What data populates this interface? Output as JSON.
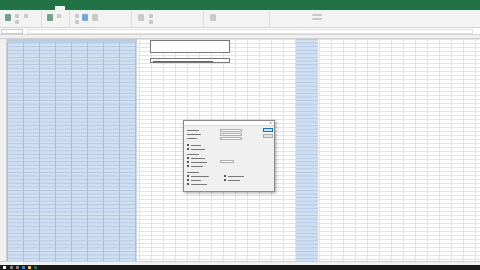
{
  "app": {
    "accent": "#217346"
  },
  "ribbon_tabs": [
    "",
    "",
    "",
    "",
    "",
    "",
    "",
    "",
    ""
  ],
  "active_tab_index": 4,
  "sheet": {
    "data_fill_color": "#cfdff2",
    "selected_column_color": "#cfdff2",
    "tabs": [
      "",
      "",
      ""
    ]
  },
  "dialog": {
    "title": "",
    "buttons": [
      "",
      ""
    ]
  },
  "taskbar": {
    "icons": [
      "windows-icon",
      "search-icon",
      "task-view-icon",
      "edge-icon",
      "explorer-icon",
      "excel-icon"
    ],
    "colors": [
      "#ffffff",
      "#bbbbbb",
      "#bbbbbb",
      "#2b88d8",
      "#f2c94c",
      "#217346"
    ]
  }
}
